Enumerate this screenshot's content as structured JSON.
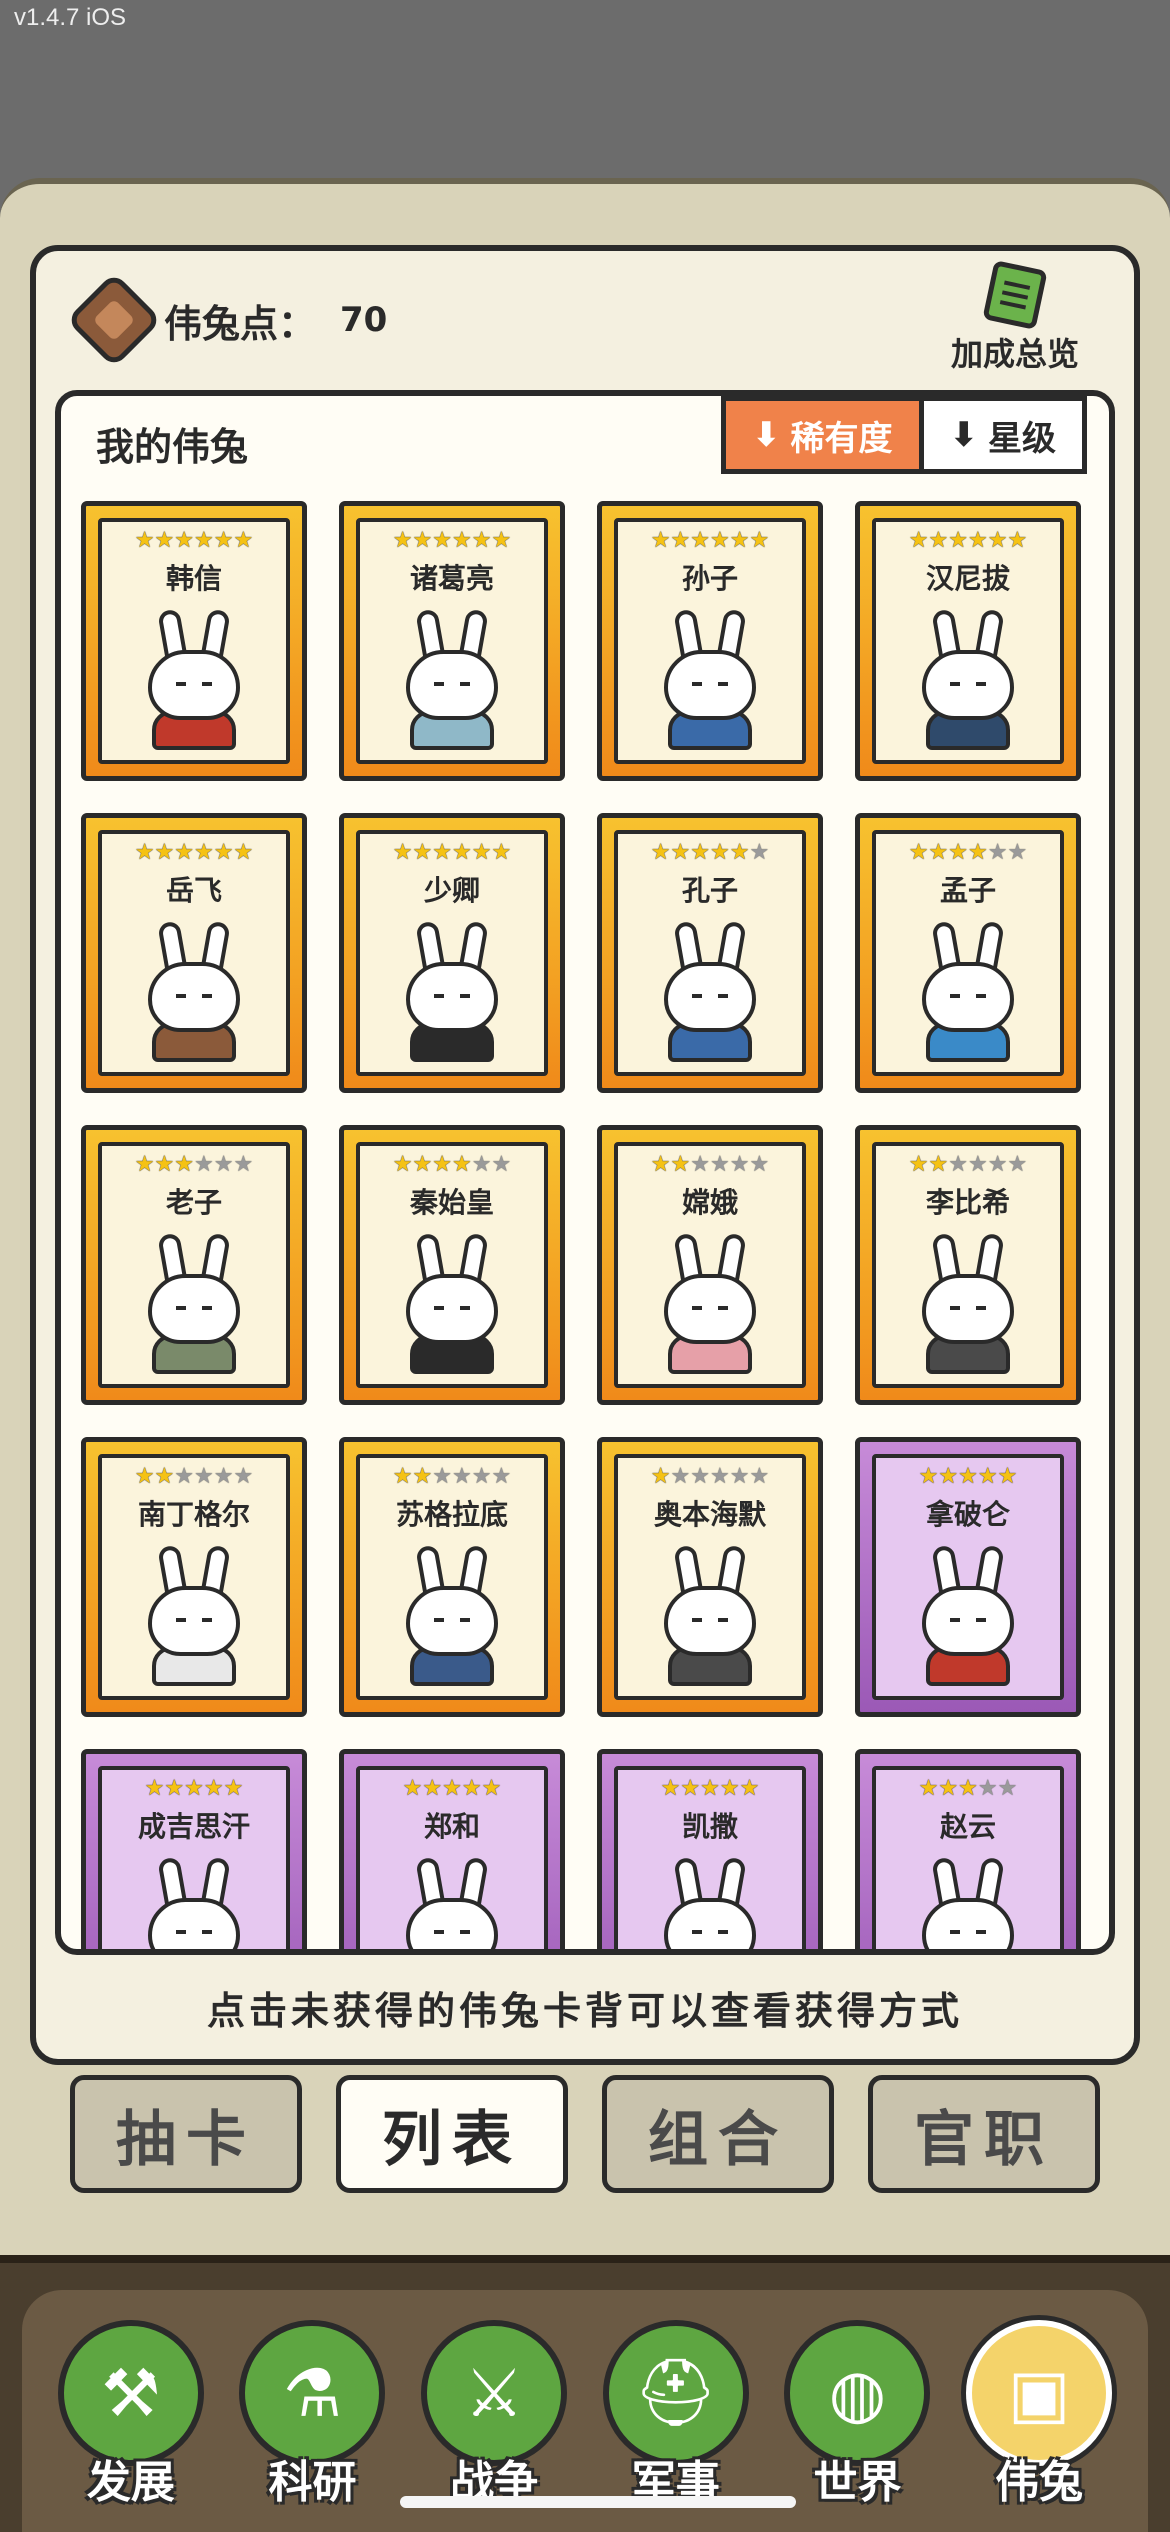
{
  "status": {
    "version": "v1.4.7 iOS"
  },
  "header": {
    "currency_label": "伟兔点：",
    "currency_value": "70",
    "bonus_label": "加成总览"
  },
  "panel": {
    "title": "我的伟兔",
    "sort": [
      {
        "label": "稀有度",
        "active": true
      },
      {
        "label": "星级",
        "active": false
      }
    ]
  },
  "cards": [
    {
      "name": "韩信",
      "stars": 6,
      "max": 6,
      "frame": "gold",
      "accent": "#c0392b"
    },
    {
      "name": "诸葛亮",
      "stars": 6,
      "max": 6,
      "frame": "gold",
      "accent": "#8fb8c8"
    },
    {
      "name": "孙子",
      "stars": 6,
      "max": 6,
      "frame": "gold",
      "accent": "#3a6aa8"
    },
    {
      "name": "汉尼拔",
      "stars": 6,
      "max": 6,
      "frame": "gold",
      "accent": "#2f4a6b"
    },
    {
      "name": "岳飞",
      "stars": 6,
      "max": 6,
      "frame": "gold",
      "accent": "#8b5a3a"
    },
    {
      "name": "少卿",
      "stars": 6,
      "max": 6,
      "frame": "gold",
      "accent": "#2a2a2a"
    },
    {
      "name": "孔子",
      "stars": 5,
      "max": 6,
      "frame": "gold",
      "accent": "#3a6aa8"
    },
    {
      "name": "孟子",
      "stars": 4,
      "max": 6,
      "frame": "gold",
      "accent": "#3a8ac8"
    },
    {
      "name": "老子",
      "stars": 3,
      "max": 6,
      "frame": "gold",
      "accent": "#7a8a6a"
    },
    {
      "name": "秦始皇",
      "stars": 4,
      "max": 6,
      "frame": "gold",
      "accent": "#2a2a2a"
    },
    {
      "name": "嫦娥",
      "stars": 2,
      "max": 6,
      "frame": "gold",
      "accent": "#e6a0a8"
    },
    {
      "name": "李比希",
      "stars": 2,
      "max": 6,
      "frame": "gold",
      "accent": "#4a4a4a"
    },
    {
      "name": "南丁格尔",
      "stars": 2,
      "max": 6,
      "frame": "gold",
      "accent": "#e8e8e8"
    },
    {
      "name": "苏格拉底",
      "stars": 2,
      "max": 6,
      "frame": "gold",
      "accent": "#3a5a8a"
    },
    {
      "name": "奥本海默",
      "stars": 1,
      "max": 6,
      "frame": "gold",
      "accent": "#4a4a4a"
    },
    {
      "name": "拿破仑",
      "stars": 5,
      "max": 5,
      "frame": "purple",
      "accent": "#c0392b"
    },
    {
      "name": "成吉思汗",
      "stars": 5,
      "max": 5,
      "frame": "purple",
      "accent": "#4a6a8a"
    },
    {
      "name": "郑和",
      "stars": 5,
      "max": 5,
      "frame": "purple",
      "accent": "#6a4a2a"
    },
    {
      "name": "凯撒",
      "stars": 5,
      "max": 5,
      "frame": "purple",
      "accent": "#c0392b"
    },
    {
      "name": "赵云",
      "stars": 3,
      "max": 5,
      "frame": "purple",
      "accent": "#4a4a6a"
    }
  ],
  "hint": "点击未获得的伟兔卡背可以查看获得方式",
  "tabs": [
    {
      "label": "抽卡",
      "active": false
    },
    {
      "label": "列表",
      "active": true
    },
    {
      "label": "组合",
      "active": false
    },
    {
      "label": "官职",
      "active": false
    }
  ],
  "nav": [
    {
      "label": "发展",
      "icon": "hammer-icon",
      "glyph": "⚒",
      "active": false
    },
    {
      "label": "科研",
      "icon": "flask-icon",
      "glyph": "⚗",
      "active": false
    },
    {
      "label": "战争",
      "icon": "swords-icon",
      "glyph": "⚔",
      "active": false
    },
    {
      "label": "军事",
      "icon": "helmet-icon",
      "glyph": "⛑",
      "active": false
    },
    {
      "label": "世界",
      "icon": "globe-icon",
      "glyph": "◍",
      "active": false
    },
    {
      "label": "伟兔",
      "icon": "rabbit-card-icon",
      "glyph": "▣",
      "active": true
    }
  ]
}
